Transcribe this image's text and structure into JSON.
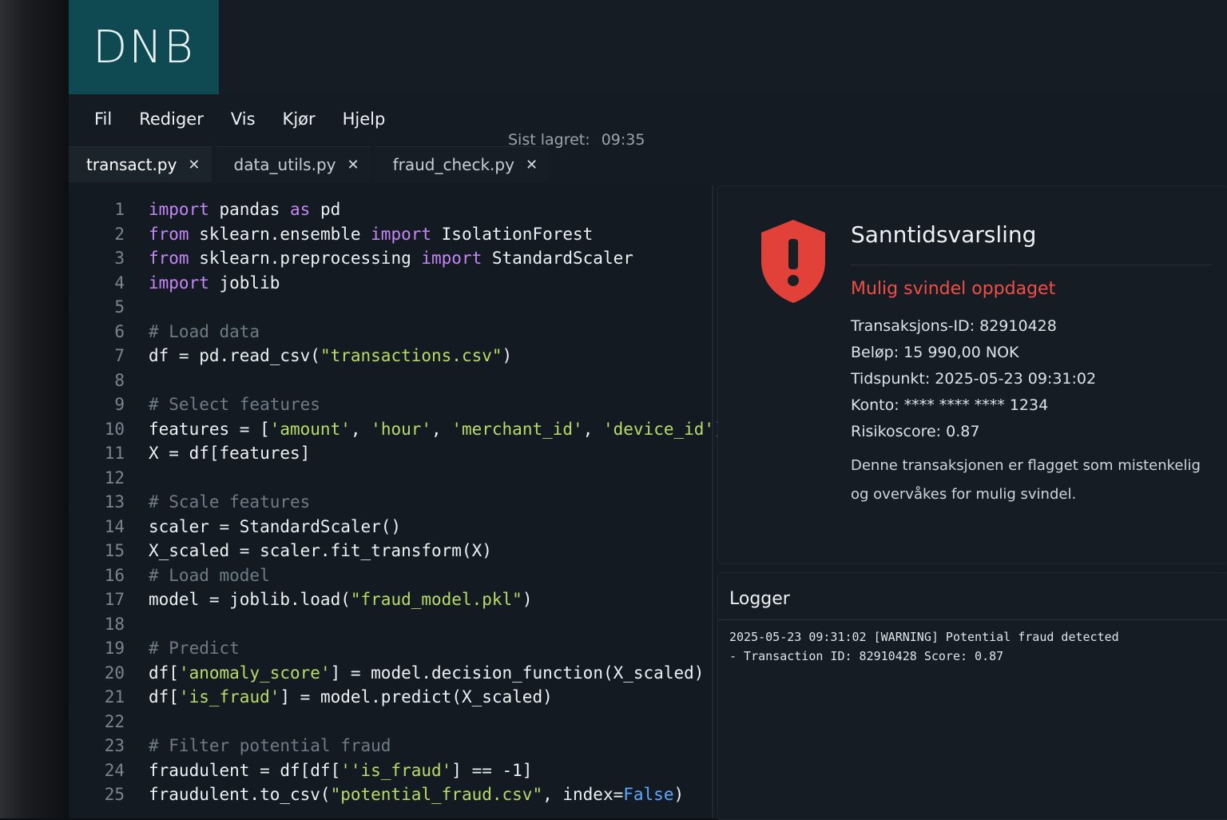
{
  "brand": {
    "logo_text": "DNB",
    "logo_color": "#0f4a52"
  },
  "menu": {
    "items": [
      "Fil",
      "Rediger",
      "Vis",
      "Kjør",
      "Hjelp"
    ]
  },
  "status": {
    "saved_label": "Sist lagret:",
    "saved_time": "09:35"
  },
  "tabs": [
    {
      "label": "transact.py",
      "active": true
    },
    {
      "label": "data_utils.py",
      "active": false
    },
    {
      "label": "fraud_check.py",
      "active": false
    }
  ],
  "code": {
    "lines": [
      {
        "n": "1",
        "tokens": [
          [
            "kw",
            "import"
          ],
          [
            "txt",
            " pandas "
          ],
          [
            "kw",
            "as"
          ],
          [
            "txt",
            " pd"
          ]
        ]
      },
      {
        "n": "2",
        "tokens": [
          [
            "kw",
            "from"
          ],
          [
            "txt",
            " sklearn.ensemble "
          ],
          [
            "kw",
            "import"
          ],
          [
            "txt",
            " IsolationForest"
          ]
        ]
      },
      {
        "n": "3",
        "tokens": [
          [
            "kw",
            "from"
          ],
          [
            "txt",
            " sklearn.preprocessing "
          ],
          [
            "kw",
            "import"
          ],
          [
            "txt",
            " StandardScaler"
          ]
        ]
      },
      {
        "n": "4",
        "tokens": [
          [
            "kw",
            "import"
          ],
          [
            "txt",
            " joblib"
          ]
        ]
      },
      {
        "n": "5",
        "tokens": []
      },
      {
        "n": "6",
        "tokens": [
          [
            "cm",
            "# Load data"
          ]
        ]
      },
      {
        "n": "7",
        "tokens": [
          [
            "txt",
            "df = pd.read_csv("
          ],
          [
            "str",
            "\"transactions.csv\""
          ],
          [
            "txt",
            ")"
          ]
        ]
      },
      {
        "n": "8",
        "tokens": []
      },
      {
        "n": "9",
        "tokens": [
          [
            "cm",
            "# Select features"
          ]
        ]
      },
      {
        "n": "10",
        "tokens": [
          [
            "txt",
            "features = ["
          ],
          [
            "str",
            "'amount'"
          ],
          [
            "txt",
            ", "
          ],
          [
            "str",
            "'hour'"
          ],
          [
            "txt",
            ", "
          ],
          [
            "str",
            "'merchant_id'"
          ],
          [
            "txt",
            ", "
          ],
          [
            "str",
            "'device_id'"
          ],
          [
            "txt",
            "]"
          ]
        ]
      },
      {
        "n": "11",
        "tokens": [
          [
            "txt",
            "X = df[features]"
          ]
        ]
      },
      {
        "n": "12",
        "tokens": []
      },
      {
        "n": "13",
        "tokens": [
          [
            "cm",
            "# Scale features"
          ]
        ]
      },
      {
        "n": "14",
        "tokens": [
          [
            "txt",
            "scaler = StandardScaler()"
          ]
        ]
      },
      {
        "n": "15",
        "tokens": [
          [
            "txt",
            "X_scaled = scaler.fit_transform(X)"
          ]
        ]
      },
      {
        "n": "16",
        "tokens": [
          [
            "cm",
            "# Load model"
          ]
        ]
      },
      {
        "n": "17",
        "tokens": [
          [
            "txt",
            "model = joblib.load("
          ],
          [
            "str",
            "\"fraud_model.pkl\""
          ],
          [
            "txt",
            ")"
          ]
        ]
      },
      {
        "n": "18",
        "tokens": []
      },
      {
        "n": "19",
        "tokens": [
          [
            "cm",
            "# Predict"
          ]
        ]
      },
      {
        "n": "20",
        "tokens": [
          [
            "txt",
            "df["
          ],
          [
            "str",
            "'anomaly_score'"
          ],
          [
            "txt",
            "] = model.decision_function(X_scaled)"
          ]
        ]
      },
      {
        "n": "21",
        "tokens": [
          [
            "txt",
            "df["
          ],
          [
            "str",
            "'is_fraud'"
          ],
          [
            "txt",
            "] = model.predict(X_scaled)"
          ]
        ]
      },
      {
        "n": "22",
        "tokens": []
      },
      {
        "n": "23",
        "tokens": [
          [
            "cm",
            "# Filter potential fraud"
          ]
        ]
      },
      {
        "n": "24",
        "tokens": [
          [
            "txt",
            "fraudulent = df[df["
          ],
          [
            "str",
            "''is_fraud'"
          ],
          [
            "txt",
            "] == -1]"
          ]
        ]
      },
      {
        "n": "25",
        "tokens": [
          [
            "txt",
            "fraudulent.to_csv("
          ],
          [
            "str",
            "\"potential_fraud.csv\""
          ],
          [
            "txt",
            ", index="
          ],
          [
            "bool",
            "False"
          ],
          [
            "txt",
            ")"
          ]
        ]
      }
    ]
  },
  "alert": {
    "title": "Sanntidsvarsling",
    "subtitle": "Mulig svindel oppdaget",
    "details": [
      "Transaksjons-ID: 82910428",
      "Beløp: 15 990,00 NOK",
      "Tidspunkt: 2025-05-23 09:31:02",
      "Konto: **** **** **** 1234",
      "Risikoscore: 0.87"
    ],
    "description": "Denne transaksjonen er flagget som mistenkelig og overvåkes for mulig svindel.",
    "accent_color": "#ef4f44"
  },
  "log": {
    "title": "Logger",
    "text": "2025-05-23 09:31:02 [WARNING] Potential fraud detected\n- Transaction ID: 82910428 Score: 0.87"
  }
}
